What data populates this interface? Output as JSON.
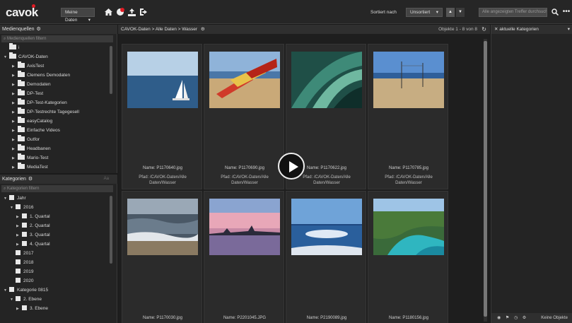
{
  "topbar": {
    "logo": "cavok",
    "view_select": "Meine Daten",
    "sort_label": "Sortiert nach",
    "sort_select": "Unsortiert",
    "sort_direction_up": "▲",
    "sort_direction_down": "▼",
    "search_placeholder": "Alle angezeigten Treffer durchsuchen",
    "search_icon": "search-icon",
    "more_icon": "more-icon"
  },
  "media": {
    "title": "Medienquellen",
    "search_placeholder": "Medienquellen filtern",
    "items": [
      {
        "label": "i",
        "level": 0,
        "expanded": false
      },
      {
        "label": "CAVOK-Daten",
        "level": 0,
        "expanded": true
      },
      {
        "label": "AxisTest",
        "level": 1,
        "expanded": false
      },
      {
        "label": "Clemens Demodaten",
        "level": 1,
        "expanded": false
      },
      {
        "label": "Demodaten",
        "level": 1,
        "expanded": false
      },
      {
        "label": "DP-Test",
        "level": 1,
        "expanded": false
      },
      {
        "label": "DP-Test-Kategorien",
        "level": 1,
        "expanded": false
      },
      {
        "label": "DP-Testrechte Tagegesell",
        "level": 1,
        "expanded": false
      },
      {
        "label": "easyCatalog",
        "level": 1,
        "expanded": false
      },
      {
        "label": "Einfache Videos",
        "level": 1,
        "expanded": false
      },
      {
        "label": "Gutfor",
        "level": 1,
        "expanded": false
      },
      {
        "label": "Headbanen",
        "level": 1,
        "expanded": false
      },
      {
        "label": "Mario-Test",
        "level": 1,
        "expanded": false
      },
      {
        "label": "MediaTest",
        "level": 1,
        "expanded": false
      }
    ]
  },
  "categories": {
    "title": "Kategorien",
    "hint": "Aa",
    "search_placeholder": "Kategorien filtern",
    "items": [
      {
        "label": "Jahr",
        "level": 0
      },
      {
        "label": "2016",
        "level": 1
      },
      {
        "label": "1. Quartal",
        "level": 2
      },
      {
        "label": "2. Quartal",
        "level": 2
      },
      {
        "label": "3. Quartal",
        "level": 2
      },
      {
        "label": "4. Quartal",
        "level": 2
      },
      {
        "label": "2017",
        "level": 1
      },
      {
        "label": "2018",
        "level": 1
      },
      {
        "label": "2019",
        "level": 1
      },
      {
        "label": "2020",
        "level": 1
      },
      {
        "label": "Kategorie 0815",
        "level": 0
      },
      {
        "label": "2. Ebene",
        "level": 1
      },
      {
        "label": "3. Ebene",
        "level": 2
      }
    ]
  },
  "main": {
    "breadcrumb": "CAVOK-Daten > Alle Daten > Wasser",
    "count": "Objekte 1 - 8 von 8",
    "name_prefix": "Name:",
    "path_prefix": "Pfad:",
    "assets": [
      {
        "name": "P1170640.jpg",
        "path_line1": "/CAVOK-Daten/Alle",
        "path_line2": "Daten/Wasser",
        "thumb": "sea-sailboat"
      },
      {
        "name": "P1170690.jpg",
        "path_line1": "/CAVOK-Daten/Alle",
        "path_line2": "Daten/Wasser",
        "thumb": "flags-beach"
      },
      {
        "name": "P1170622.jpg",
        "path_line1": "/CAVOK-Daten/Alle",
        "path_line2": "Daten/Wasser",
        "thumb": "green-abstract"
      },
      {
        "name": "P1170785.jpg",
        "path_line1": "/CAVOK-Daten/Alle",
        "path_line2": "Daten/Wasser",
        "thumb": "beach-poles"
      },
      {
        "name": "P1170030.jpg",
        "thumb": "waves-shore"
      },
      {
        "name": "P2201045.JPG",
        "thumb": "sunset-city"
      },
      {
        "name": "P2190089.jpg",
        "thumb": "sea-sun"
      },
      {
        "name": "P1180156.jpg",
        "thumb": "turquoise-cove"
      }
    ]
  },
  "right": {
    "title": "aktuelle Kategorien",
    "footer": "Keine Objekte"
  }
}
